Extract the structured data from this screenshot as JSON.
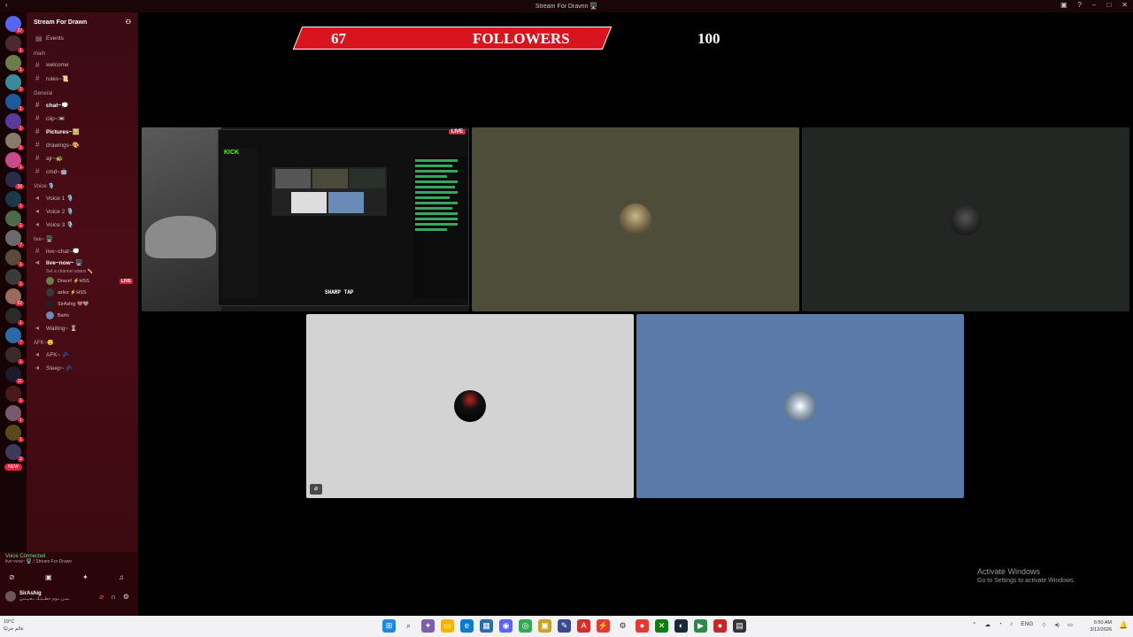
{
  "window": {
    "title": "Stream For Dravnn 🖥️"
  },
  "servers": {
    "badges": [
      "37",
      "1",
      "1",
      "1",
      "1",
      "1",
      "1",
      "1",
      "16",
      "1",
      "1",
      "7",
      "1",
      "1",
      "62",
      "1",
      "7",
      "1",
      "11",
      "1",
      "1",
      "1",
      "2"
    ],
    "new_label": "NEW"
  },
  "sidebar": {
    "guild_name": "Stream For Drawn",
    "events_label": "Events",
    "categories": {
      "main": "main",
      "general": "General",
      "voice": "Voice 🎙️",
      "live": "live~ 🖥️",
      "afk": "AFK~😴"
    },
    "channels": {
      "welcome": "welcome",
      "rules": "rules~📜",
      "chat": "chat~💭",
      "clip": "clip~📼",
      "pictures": "Pictures~🖼️",
      "drawings": "drawings~🎨",
      "ajr": "ajr~🐢",
      "cmd": "cmd~🤖",
      "voice1": "Voice 1 🎙️",
      "voice2": "Voice 2 🎙️",
      "voice3": "Voice 3 🎙️",
      "livechat": "live~chat~💭",
      "livenow": "live~now~ 🖥️",
      "livenow_status": "Set a channel status ✏️",
      "waiting": "Waiting~ ⏳",
      "afk": "AFK~ 💤",
      "sleep": "Sleep~ 💤"
    },
    "users": [
      {
        "name": "Dravn! ⚡HSS",
        "live": "LIVE"
      },
      {
        "name": "azlez ⚡HSS"
      },
      {
        "name": "SirAshig 🤎🩶"
      },
      {
        "name": "Ba#o"
      }
    ]
  },
  "voice_panel": {
    "status": "Voice Connected",
    "channel": "live~now~ 🖥️ / Stream For Drawn",
    "user": "SirAshig",
    "user_status": "ـمـن يـوم حطـيتـك بـعـيـنـي"
  },
  "overlay": {
    "followers_count": "67",
    "followers_label": "FOLLOWERS",
    "followers_goal": "100",
    "stream_badge": "LIVE",
    "kick_logo": "KICK",
    "stream_text": "SHARP TAP"
  },
  "activate": {
    "title": "Activate Windows",
    "subtitle": "Go to Settings to activate Windows."
  },
  "taskbar": {
    "weather_temp": "19°C",
    "weather_text": "غائم جزئيًا",
    "lang": "ENG",
    "time": "6:50 AM",
    "date": "3/12/2026"
  }
}
